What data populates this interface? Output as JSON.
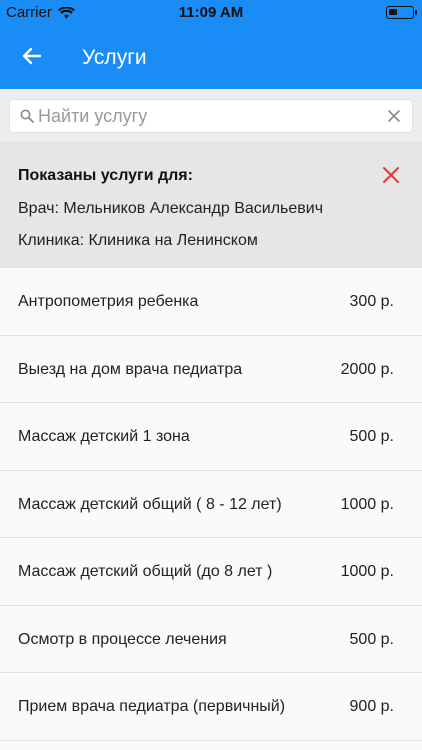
{
  "status_bar": {
    "carrier": "Carrier",
    "time": "11:09 AM"
  },
  "header": {
    "title": "Услуги",
    "background_color": "#1a8cf5"
  },
  "search": {
    "placeholder": "Найти услугу",
    "value": ""
  },
  "filter": {
    "title": "Показаны услуги для:",
    "doctor": "Врач: Мельников Александр Васильевич",
    "clinic": "Клиника: Клиника на Ленинском",
    "close_color": "#e53935"
  },
  "services": [
    {
      "name": "Антропометрия ребенка",
      "price": "300 р."
    },
    {
      "name": "Выезд на дом врача педиатра",
      "price": "2000 р."
    },
    {
      "name": "Массаж детский 1 зона",
      "price": "500 р."
    },
    {
      "name": "Массаж детский общий ( 8 - 12 лет)",
      "price": "1000 р."
    },
    {
      "name": "Массаж детский общий (до 8 лет )",
      "price": "1000 р."
    },
    {
      "name": "Осмотр в процессе лечения",
      "price": "500 р."
    },
    {
      "name": "Прием врача педиатра (первичный)",
      "price": "900 р."
    }
  ]
}
